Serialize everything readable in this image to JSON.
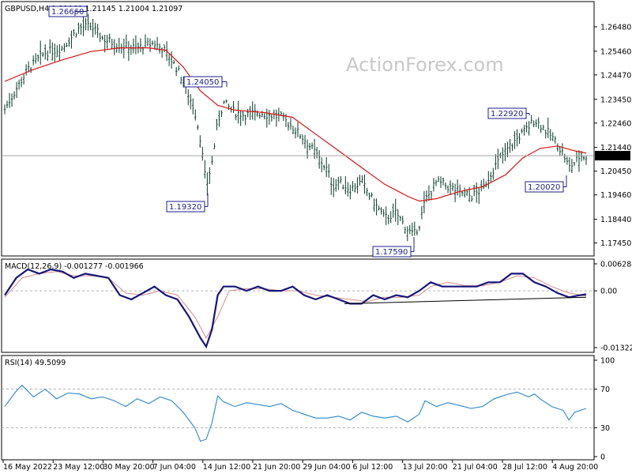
{
  "chart_data": [
    {
      "type": "ohlc",
      "title": "GBPUSD,H4  1.21060 1.21145 1.21004 1.21097",
      "watermark": "ActionForex.com",
      "ylim": [
        1.1704,
        1.2694
      ],
      "y_ticks": [
        "1.26480",
        "1.25460",
        "1.24470",
        "1.23450",
        "1.22460",
        "1.21440",
        "1.20450",
        "1.19460",
        "1.18440",
        "1.17450"
      ],
      "x_ticks": [
        "16 May 2022",
        "23 May 12:00",
        "30 May 20:00",
        "7 Jun 04:00",
        "14 Jun 12:00",
        "21 Jun 20:00",
        "29 Jun 04:00",
        "6 Jul 12:00",
        "13 Jul 20:00",
        "21 Jul 04:00",
        "28 Jul 12:00",
        "4 Aug 20:00"
      ],
      "current_price": "1.21097",
      "annotations": [
        "1.26660",
        "1.24050",
        "1.19320",
        "1.17590",
        "1.22920",
        "1.20020"
      ],
      "price_path": [
        [
          0,
          1.2305
        ],
        [
          4,
          1.247
        ],
        [
          7,
          1.254
        ],
        [
          10,
          1.256
        ],
        [
          13,
          1.2645
        ],
        [
          15,
          1.265
        ],
        [
          17,
          1.26
        ],
        [
          20,
          1.257
        ],
        [
          23,
          1.256
        ],
        [
          26,
          1.258
        ],
        [
          28,
          1.2545
        ],
        [
          30,
          1.247
        ],
        [
          31,
          1.242
        ],
        [
          33,
          1.23
        ],
        [
          34,
          1.218
        ],
        [
          35,
          1.198
        ],
        [
          36,
          1.208
        ],
        [
          37,
          1.225
        ],
        [
          38,
          1.233
        ],
        [
          40,
          1.229
        ],
        [
          42,
          1.228
        ],
        [
          44,
          1.229
        ],
        [
          46,
          1.228
        ],
        [
          48,
          1.227
        ],
        [
          50,
          1.223
        ],
        [
          52,
          1.218
        ],
        [
          54,
          1.212
        ],
        [
          56,
          1.205
        ],
        [
          57,
          1.198
        ],
        [
          58,
          1.2
        ],
        [
          60,
          1.197
        ],
        [
          62,
          1.2
        ],
        [
          64,
          1.192
        ],
        [
          66,
          1.185
        ],
        [
          68,
          1.187
        ],
        [
          70,
          1.18
        ],
        [
          71,
          1.1775
        ],
        [
          72,
          1.182
        ],
        [
          73,
          1.192
        ],
        [
          75,
          1.2
        ],
        [
          77,
          1.198
        ],
        [
          79,
          1.196
        ],
        [
          81,
          1.194
        ],
        [
          83,
          1.197
        ],
        [
          85,
          1.206
        ],
        [
          87,
          1.213
        ],
        [
          89,
          1.218
        ],
        [
          91,
          1.223
        ],
        [
          92,
          1.226
        ],
        [
          93,
          1.224
        ],
        [
          95,
          1.219
        ],
        [
          97,
          1.212
        ],
        [
          98,
          1.206
        ],
        [
          99,
          1.208
        ],
        [
          100,
          1.211
        ],
        [
          101,
          1.2105
        ]
      ],
      "moving_average_path": [
        [
          0,
          1.242
        ],
        [
          5,
          1.247
        ],
        [
          10,
          1.251
        ],
        [
          15,
          1.2545
        ],
        [
          20,
          1.256
        ],
        [
          25,
          1.256
        ],
        [
          28,
          1.255
        ],
        [
          31,
          1.248
        ],
        [
          34,
          1.238
        ],
        [
          37,
          1.232
        ],
        [
          40,
          1.23
        ],
        [
          45,
          1.229
        ],
        [
          50,
          1.227
        ],
        [
          54,
          1.22
        ],
        [
          58,
          1.213
        ],
        [
          62,
          1.206
        ],
        [
          66,
          1.199
        ],
        [
          70,
          1.194
        ],
        [
          72,
          1.192
        ],
        [
          75,
          1.193
        ],
        [
          79,
          1.196
        ],
        [
          83,
          1.198
        ],
        [
          87,
          1.203
        ],
        [
          90,
          1.21
        ],
        [
          93,
          1.214
        ],
        [
          96,
          1.215
        ],
        [
          99,
          1.213
        ],
        [
          101,
          1.212
        ]
      ]
    },
    {
      "type": "line",
      "title": "MACD(12,26,9) -0.001277 -0.001966",
      "ylim": [
        -0.01322,
        0.00628
      ],
      "y_ticks": [
        "0.006285",
        "0.00",
        "-0.013223"
      ],
      "macd_path": [
        [
          0,
          -0.001
        ],
        [
          2,
          0.003
        ],
        [
          4,
          0.005
        ],
        [
          6,
          0.004
        ],
        [
          8,
          0.005
        ],
        [
          10,
          0.0045
        ],
        [
          12,
          0.003
        ],
        [
          14,
          0.004
        ],
        [
          16,
          0.0035
        ],
        [
          18,
          0.003
        ],
        [
          20,
          -0.001
        ],
        [
          22,
          -0.002
        ],
        [
          24,
          -0.0005
        ],
        [
          26,
          0.001
        ],
        [
          28,
          -0.001
        ],
        [
          30,
          -0.002
        ],
        [
          32,
          -0.006
        ],
        [
          34,
          -0.011
        ],
        [
          35,
          -0.013
        ],
        [
          36,
          -0.009
        ],
        [
          37,
          -0.001
        ],
        [
          38,
          0.001
        ],
        [
          40,
          0.001
        ],
        [
          42,
          0.0
        ],
        [
          44,
          0.001
        ],
        [
          46,
          0.0
        ],
        [
          48,
          0.0
        ],
        [
          50,
          0.001
        ],
        [
          52,
          -0.001
        ],
        [
          54,
          -0.002
        ],
        [
          56,
          -0.001
        ],
        [
          58,
          -0.002
        ],
        [
          60,
          -0.003
        ],
        [
          62,
          -0.003
        ],
        [
          64,
          -0.001
        ],
        [
          66,
          -0.002
        ],
        [
          68,
          -0.001
        ],
        [
          70,
          -0.0015
        ],
        [
          72,
          0.0
        ],
        [
          74,
          0.002
        ],
        [
          76,
          0.001
        ],
        [
          78,
          0.001
        ],
        [
          80,
          0.001
        ],
        [
          82,
          0.001
        ],
        [
          84,
          0.002
        ],
        [
          86,
          0.002
        ],
        [
          88,
          0.004
        ],
        [
          90,
          0.004
        ],
        [
          92,
          0.002
        ],
        [
          94,
          0.001
        ],
        [
          96,
          -0.0005
        ],
        [
          98,
          -0.0015
        ],
        [
          100,
          -0.001
        ],
        [
          101,
          -0.0008
        ]
      ],
      "signal_path": [
        [
          0,
          -0.0015
        ],
        [
          3,
          0.003
        ],
        [
          6,
          0.004
        ],
        [
          9,
          0.0045
        ],
        [
          12,
          0.0035
        ],
        [
          15,
          0.0035
        ],
        [
          18,
          0.003
        ],
        [
          21,
          -0.0005
        ],
        [
          24,
          -0.001
        ],
        [
          27,
          0.0
        ],
        [
          30,
          -0.001
        ],
        [
          33,
          -0.006
        ],
        [
          35,
          -0.011
        ],
        [
          37,
          -0.006
        ],
        [
          39,
          0.0
        ],
        [
          42,
          0.0005
        ],
        [
          45,
          0.0005
        ],
        [
          48,
          0.0
        ],
        [
          51,
          0.0
        ],
        [
          54,
          -0.001
        ],
        [
          57,
          -0.0015
        ],
        [
          60,
          -0.002
        ],
        [
          63,
          -0.0025
        ],
        [
          66,
          -0.0015
        ],
        [
          69,
          -0.0015
        ],
        [
          72,
          -0.001
        ],
        [
          74,
          0.001
        ],
        [
          77,
          0.002
        ],
        [
          80,
          0.0012
        ],
        [
          83,
          0.0012
        ],
        [
          86,
          0.002
        ],
        [
          89,
          0.0035
        ],
        [
          92,
          0.003
        ],
        [
          95,
          0.001
        ],
        [
          98,
          -0.0005
        ],
        [
          101,
          -0.0012
        ]
      ],
      "trendline": [
        [
          59,
          -0.003
        ],
        [
          101,
          -0.0015
        ]
      ]
    },
    {
      "type": "line",
      "title": "RSI(14) 49.5099",
      "ylim": [
        0,
        100
      ],
      "y_ticks": [
        "100",
        "70",
        "30",
        "0"
      ],
      "reference_lines": [
        70,
        30
      ],
      "rsi_path": [
        [
          0,
          52
        ],
        [
          2,
          68
        ],
        [
          3,
          74
        ],
        [
          5,
          62
        ],
        [
          7,
          70
        ],
        [
          9,
          60
        ],
        [
          11,
          66
        ],
        [
          13,
          65
        ],
        [
          15,
          60
        ],
        [
          17,
          62
        ],
        [
          19,
          58
        ],
        [
          21,
          52
        ],
        [
          23,
          60
        ],
        [
          25,
          55
        ],
        [
          27,
          62
        ],
        [
          29,
          58
        ],
        [
          31,
          46
        ],
        [
          33,
          30
        ],
        [
          34,
          16
        ],
        [
          35,
          18
        ],
        [
          36,
          35
        ],
        [
          37,
          63
        ],
        [
          38,
          57
        ],
        [
          40,
          52
        ],
        [
          42,
          56
        ],
        [
          44,
          54
        ],
        [
          46,
          52
        ],
        [
          48,
          55
        ],
        [
          50,
          48
        ],
        [
          52,
          44
        ],
        [
          54,
          40
        ],
        [
          56,
          40
        ],
        [
          58,
          42
        ],
        [
          60,
          38
        ],
        [
          62,
          46
        ],
        [
          64,
          42
        ],
        [
          66,
          40
        ],
        [
          68,
          42
        ],
        [
          70,
          36
        ],
        [
          72,
          44
        ],
        [
          73,
          58
        ],
        [
          75,
          52
        ],
        [
          77,
          56
        ],
        [
          79,
          53
        ],
        [
          81,
          50
        ],
        [
          83,
          52
        ],
        [
          85,
          60
        ],
        [
          87,
          64
        ],
        [
          89,
          67
        ],
        [
          91,
          62
        ],
        [
          92,
          65
        ],
        [
          93,
          60
        ],
        [
          95,
          52
        ],
        [
          97,
          48
        ],
        [
          98,
          38
        ],
        [
          99,
          46
        ],
        [
          101,
          50
        ]
      ]
    }
  ]
}
